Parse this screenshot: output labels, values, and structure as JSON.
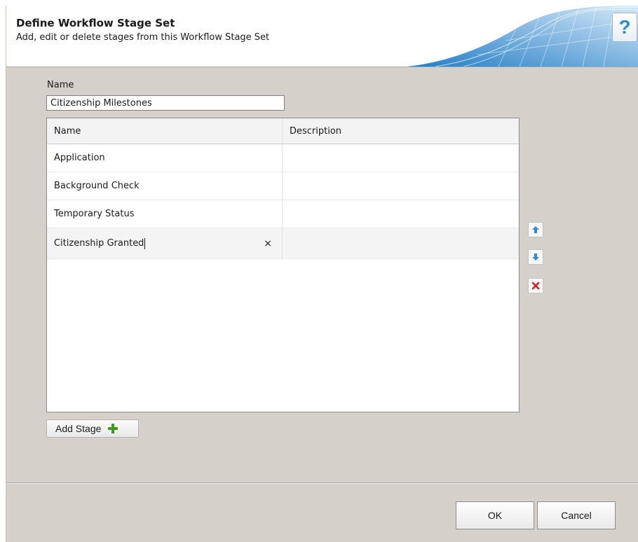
{
  "header": {
    "title": "Define Workflow Stage Set",
    "subtitle": "Add, edit or delete stages from this Workflow Stage Set",
    "help_label": "?"
  },
  "form": {
    "name_label": "Name",
    "name_value": "Citizenship Milestones"
  },
  "grid": {
    "columns": [
      "Name",
      "Description"
    ],
    "rows": [
      {
        "name": "Application",
        "description": ""
      },
      {
        "name": "Background Check",
        "description": ""
      },
      {
        "name": "Temporary Status",
        "description": ""
      },
      {
        "name": "Citizenship Granted",
        "description": ""
      }
    ],
    "clear_glyph": "×"
  },
  "side_actions": {
    "move_up_icon": "arrow-up-icon",
    "move_down_icon": "arrow-down-icon",
    "delete_icon": "red-x-icon"
  },
  "actions": {
    "add_stage_label": "Add Stage",
    "ok_label": "OK",
    "cancel_label": "Cancel"
  },
  "colors": {
    "dialog_background": "#d5d1ca",
    "accent_blue": "#2a8fd6",
    "add_green": "#3c9a1f",
    "delete_red": "#d9202a"
  }
}
